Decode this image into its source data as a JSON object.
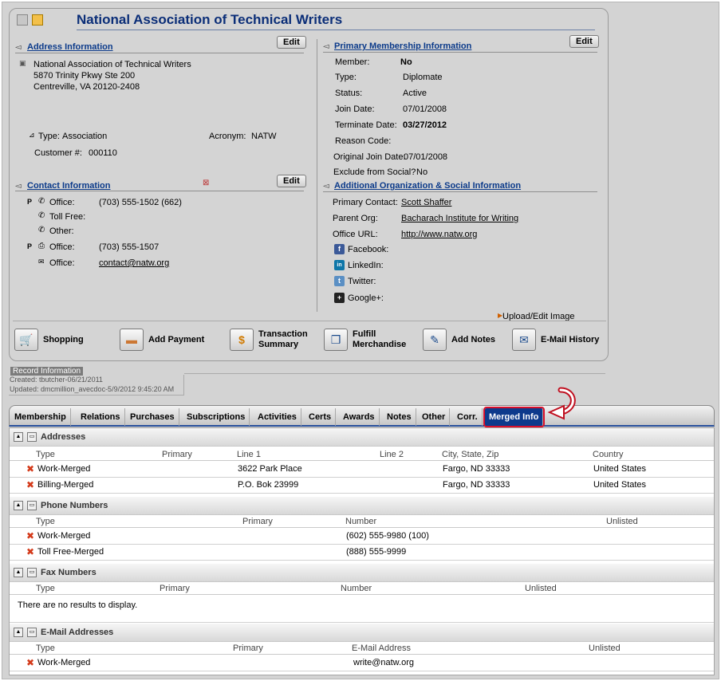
{
  "header": {
    "title": "National Association of Technical Writers"
  },
  "address": {
    "heading": "Address Information",
    "edit": "Edit",
    "lines": [
      "National Association of Technical Writers",
      "5870 Trinity Pkwy Ste 200",
      "Centreville, VA 20120-2408"
    ],
    "type_label": "Type:",
    "type_value": "Association",
    "acronym_label": "Acronym:",
    "acronym_value": "NATW",
    "customer_label": "Customer #:",
    "customer_value": "000110"
  },
  "contact": {
    "heading": "Contact Information",
    "edit": "Edit",
    "rows": [
      {
        "flag": "P",
        "label": "Office:",
        "value": "(703) 555-1502 (662)"
      },
      {
        "flag": "",
        "label": "Toll Free:",
        "value": ""
      },
      {
        "flag": "",
        "label": "Other:",
        "value": ""
      },
      {
        "flag": "P",
        "label": "Office:",
        "value": "(703) 555-1507"
      },
      {
        "flag": "",
        "label": "Office:",
        "value": "contact@natw.org"
      }
    ]
  },
  "membership": {
    "heading": "Primary Membership Information",
    "edit": "Edit",
    "rows": [
      {
        "label": "Member:",
        "value": "No"
      },
      {
        "label": "Type:",
        "value": "Diplomate"
      },
      {
        "label": "Status:",
        "value": "Active"
      },
      {
        "label": "Join Date:",
        "value": "07/01/2008"
      },
      {
        "label": "Terminate Date:",
        "value": "03/27/2012"
      },
      {
        "label": "Reason Code:",
        "value": ""
      },
      {
        "label": "Original Join Date:",
        "value": "07/01/2008"
      },
      {
        "label": "Exclude from Social?",
        "value": "No"
      }
    ]
  },
  "additional": {
    "heading": "Additional Organization & Social Information",
    "primary_contact_label": "Primary Contact:",
    "primary_contact_value": "Scott Shaffer",
    "parent_org_label": "Parent Org:",
    "parent_org_value": "Bacharach Institute for Writing",
    "office_url_label": "Office URL:",
    "office_url_value": "http://www.natw.org",
    "social": [
      {
        "name": "Facebook:",
        "color": "#3b5998",
        "glyph": "f"
      },
      {
        "name": "LinkedIn:",
        "color": "#0e76a8",
        "glyph": "in"
      },
      {
        "name": "Twitter:",
        "color": "#5a8fc4",
        "glyph": "t"
      },
      {
        "name": "Google+:",
        "color": "#222222",
        "glyph": "+"
      }
    ],
    "upload": "Upload/Edit Image"
  },
  "actions": [
    {
      "label": "Shopping",
      "icon": "cart-icon"
    },
    {
      "label": "Add Payment",
      "icon": "credit-card-icon"
    },
    {
      "label": "Transaction Summary",
      "icon": "chart-icon"
    },
    {
      "label": "Fulfill Merchandise",
      "icon": "box-icon"
    },
    {
      "label": "Add Notes",
      "icon": "notes-icon"
    },
    {
      "label": "E-Mail History",
      "icon": "mail-history-icon"
    }
  ],
  "record_info": {
    "heading": "Record Information",
    "created": "Created: tbutcher-06/21/2011",
    "updated": "Updated: dmcmillion_avecdoc-5/9/2012 9:45:20 AM"
  },
  "tabs": [
    "Membership",
    "Relations",
    "Purchases",
    "Subscriptions",
    "Activities",
    "Certs",
    "Awards",
    "Notes",
    "Other",
    "Corr.",
    "Merged Info"
  ],
  "active_tab": "Merged Info",
  "grids": {
    "addresses": {
      "title": "Addresses",
      "columns": [
        "Type",
        "Primary",
        "Line 1",
        "Line 2",
        "City, State, Zip",
        "Country"
      ],
      "rows": [
        [
          "Work-Merged",
          "",
          "3622 Park Place",
          "",
          "Fargo, ND 33333",
          "United States"
        ],
        [
          "Billing-Merged",
          "",
          "P.O. Bok 23999",
          "",
          "Fargo, ND 33333",
          "United States"
        ]
      ]
    },
    "phones": {
      "title": "Phone Numbers",
      "columns": [
        "Type",
        "Primary",
        "Number",
        "Unlisted"
      ],
      "rows": [
        [
          "Work-Merged",
          "",
          "(602) 555-9980 (100)",
          ""
        ],
        [
          "Toll Free-Merged",
          "",
          "(888) 555-9999",
          ""
        ]
      ]
    },
    "fax": {
      "title": "Fax Numbers",
      "columns": [
        "Type",
        "Primary",
        "Number",
        "Unlisted"
      ],
      "empty": "There are no results to display."
    },
    "emails": {
      "title": "E-Mail Addresses",
      "columns": [
        "Type",
        "Primary",
        "E-Mail Address",
        "Unlisted"
      ],
      "rows": [
        [
          "Work-Merged",
          "",
          "write@natw.org",
          ""
        ]
      ]
    }
  }
}
